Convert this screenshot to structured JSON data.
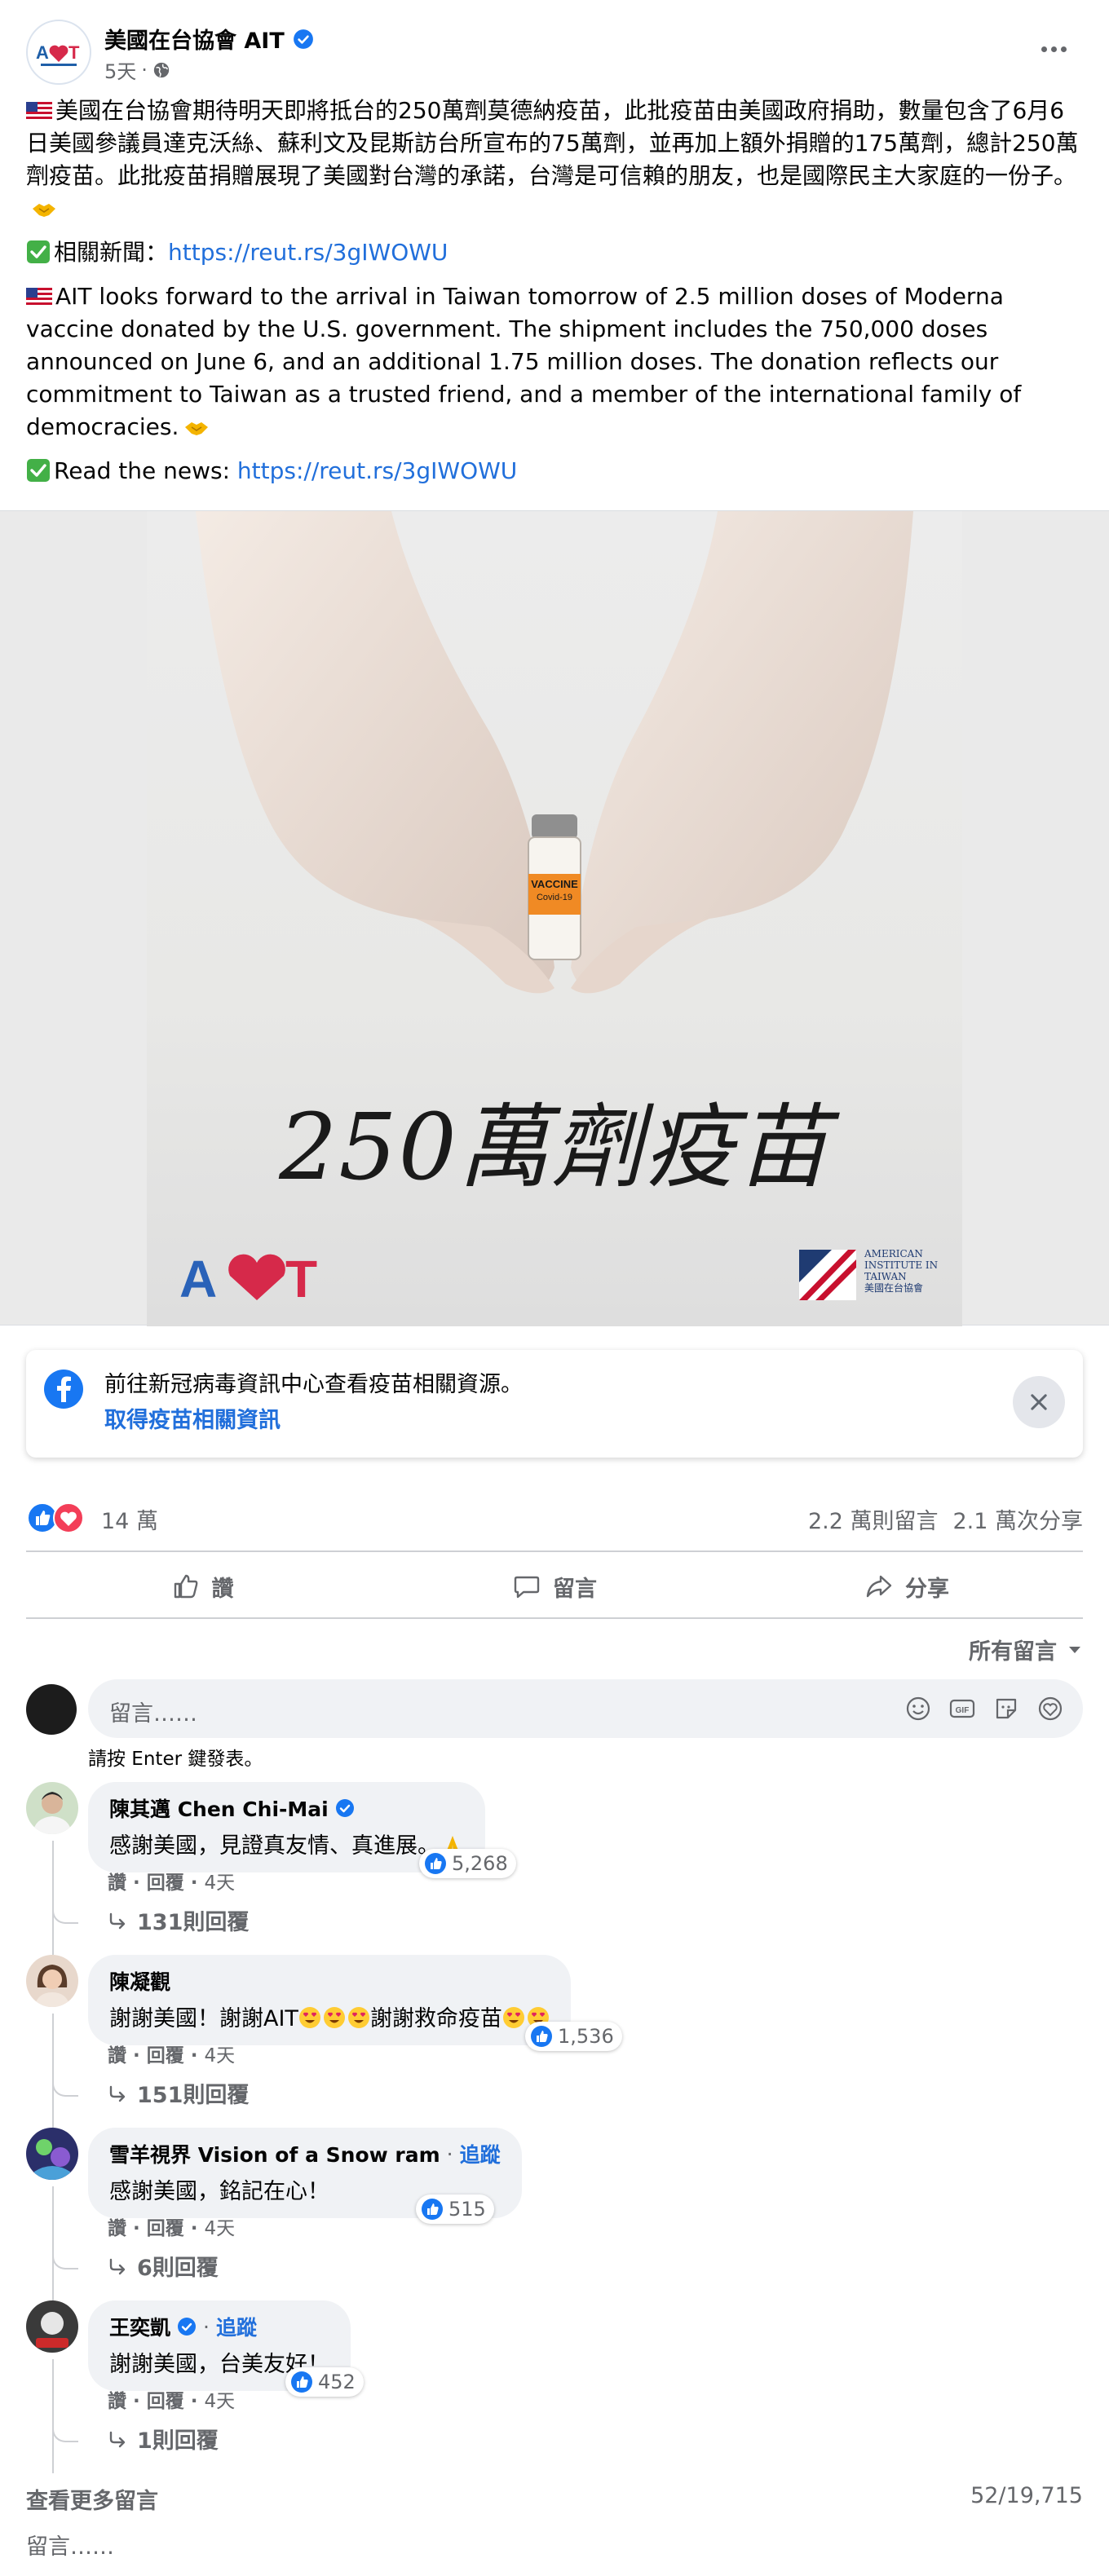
{
  "colors": {
    "link": "#216fdb",
    "secondary": "#65676b",
    "like_blue": "#1877f2",
    "love_red": "#f33e58"
  },
  "post": {
    "page_name": "美國在台協會 AIT",
    "time": "5天",
    "privacy_icon": "globe-icon",
    "paragraph_zh": "美國在台協會期待明天即將抵台的250萬劑莫德納疫苗，此批疫苗由美國政府捐助，數量包含了6月6日美國參議員達克沃絲、蘇利文及昆斯訪台所宣布的75萬劑，並再加上額外捐贈的175萬劑，總計250萬劑疫苗。此批疫苗捐贈展現了美國對台灣的承諾，台灣是可信賴的朋友，也是國際民主大家庭的一份子。",
    "news_label_zh": "相關新聞：",
    "news_link": "https://reut.rs/3gIWOWU",
    "paragraph_en": "AIT looks forward to the arrival in Taiwan tomorrow of 2.5 million doses of Moderna vaccine donated by the U.S. government. The shipment includes the 750,000 doses announced on June 6, and an additional 1.75 million doses. The donation reflects our commitment to Taiwan as a trusted friend, and a member of the international family of democracies.",
    "news_label_en": "Read the news: ",
    "image": {
      "vial_label": "VACCINE",
      "vial_sublabel": "Covid-19",
      "caption": "250萬劑疫苗",
      "logo_left": "AIT",
      "logo_right_lines": [
        "AMERICAN",
        "INSTITUTE IN",
        "TAIWAN",
        "美國在台協會"
      ]
    }
  },
  "info_card": {
    "text": "前往新冠病毒資訊中心查看疫苗相關資源。",
    "link": "取得疫苗相關資訊"
  },
  "stats": {
    "reactions": "14 萬",
    "comments": "2.2 萬則留言",
    "shares": "2.1 萬次分享"
  },
  "actions": {
    "like": "讚",
    "comment": "留言",
    "share": "分享"
  },
  "sort_label": "所有留言",
  "composer": {
    "placeholder": "留言……",
    "hint": "請按 Enter 鍵發表。"
  },
  "comments": [
    {
      "name": "陳其邁 Chen Chi-Mai",
      "verified": true,
      "follow": "",
      "text": "感謝美國，見證真友情、真進展。",
      "likes": "5,268",
      "like_label": "讚",
      "reply_label": "回覆",
      "time": "4天",
      "replies": "131則回覆"
    },
    {
      "name": "陳凝觀",
      "verified": false,
      "follow": "",
      "text": "謝謝美國！謝謝AIT",
      "text_tail": "謝謝救命疫苗",
      "likes": "1,536",
      "like_label": "讚",
      "reply_label": "回覆",
      "time": "4天",
      "replies": "151則回覆"
    },
    {
      "name": "雪羊視界 Vision of a Snow ram",
      "verified": false,
      "follow": "追蹤",
      "text": "感謝美國，銘記在心！",
      "likes": "515",
      "like_label": "讚",
      "reply_label": "回覆",
      "time": "4天",
      "replies": "6則回覆"
    },
    {
      "name": "王奕凱",
      "verified": true,
      "follow": "追蹤",
      "text": "謝謝美國，台美友好！",
      "likes": "452",
      "like_label": "讚",
      "reply_label": "回覆",
      "time": "4天",
      "replies": "1則回覆"
    }
  ],
  "footer": {
    "more_comments": "查看更多留言",
    "count": "52/19,715",
    "composer_placeholder": "留言……"
  }
}
